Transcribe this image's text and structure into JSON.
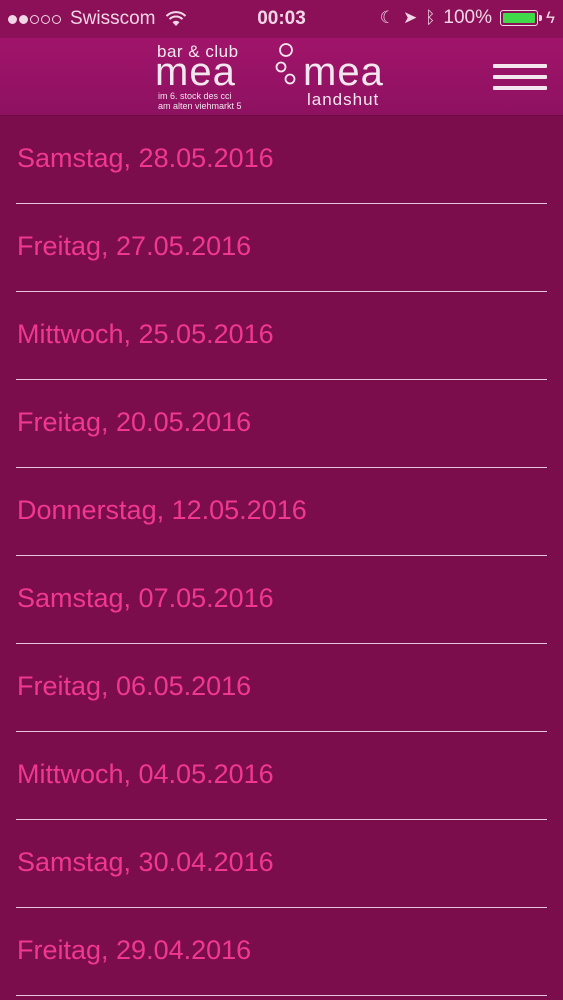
{
  "status_bar": {
    "carrier": "Swisscom",
    "signal_bars_filled": 2,
    "signal_bars_total": 5,
    "time": "00:03",
    "battery_percent": "100%",
    "icons": [
      "wifi-icon",
      "moon-icon",
      "location-arrow-icon",
      "bluetooth-icon",
      "battery-icon",
      "charging-icon"
    ]
  },
  "header": {
    "logo": {
      "top_text": "bar & club",
      "mea_left": "mea",
      "sub_line1": "im 6. stock des cci",
      "sub_line2": "am alten viehmarkt 5",
      "mea_right": "mea",
      "city": "landshut"
    },
    "menu_icon": "hamburger-menu-icon"
  },
  "events": [
    {
      "label": "Samstag, 28.05.2016"
    },
    {
      "label": "Freitag, 27.05.2016"
    },
    {
      "label": "Mittwoch, 25.05.2016"
    },
    {
      "label": "Freitag, 20.05.2016"
    },
    {
      "label": "Donnerstag, 12.05.2016"
    },
    {
      "label": "Samstag, 07.05.2016"
    },
    {
      "label": "Freitag, 06.05.2016"
    },
    {
      "label": "Mittwoch, 04.05.2016"
    },
    {
      "label": "Samstag, 30.04.2016"
    },
    {
      "label": "Freitag, 29.04.2016"
    }
  ],
  "colors": {
    "background": "#7c0d4d",
    "header": "#9a1366",
    "event_text": "#f0388f",
    "divider": "#e7c4d8",
    "battery": "#3fd94a"
  }
}
